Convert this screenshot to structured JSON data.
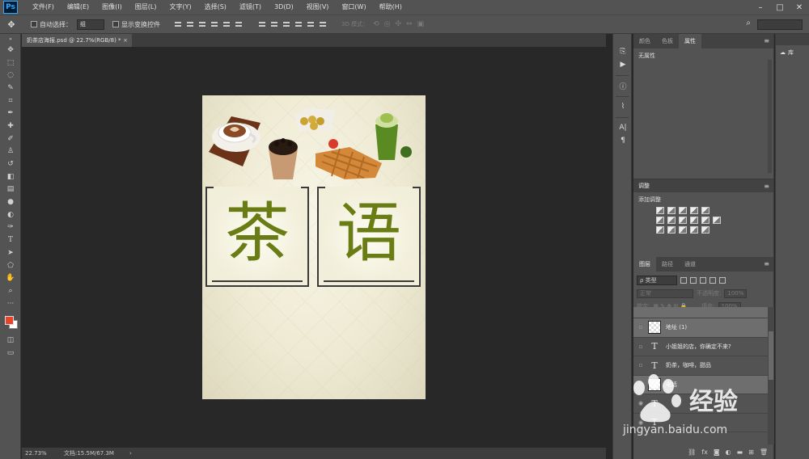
{
  "app": {
    "logo": "Ps"
  },
  "menu": [
    "文件(F)",
    "编辑(E)",
    "图像(I)",
    "图层(L)",
    "文字(Y)",
    "选择(S)",
    "滤镜(T)",
    "3D(D)",
    "视图(V)",
    "窗口(W)",
    "帮助(H)"
  ],
  "options": {
    "auto_select_label": "自动选择：",
    "auto_select_value": "组",
    "show_transform_label": "显示变换控件",
    "mode_3d_label": "3D 模式："
  },
  "document": {
    "tab_label": "奶茶店海报.psd @ 22.7%(RGB/8) *",
    "close": "×",
    "zoom": "22.73%",
    "doc_info": "文档:15.5M/67.3M",
    "status_arrow": "›"
  },
  "poster": {
    "title_char_1": "茶",
    "title_char_2": "语"
  },
  "panels": {
    "top_tabs": [
      "颜色",
      "色板",
      "属性"
    ],
    "properties_text": "无属性",
    "adjustments_tab": "调整",
    "adjustments_title": "添加调整",
    "layer_tabs": [
      "图层",
      "路径",
      "通道"
    ],
    "layer_filter": "ρ 类型",
    "blend_mode": "正常",
    "opacity_label": "不透明度:",
    "opacity_value": "100%",
    "lock_label": "锁定:",
    "fill_label": "填充:",
    "fill_value": "100%",
    "layers": [
      {
        "name": "",
        "kind": "image",
        "selected": true
      },
      {
        "name": "地址 (1)",
        "kind": "image",
        "selected": true
      },
      {
        "name": "小姐姐的店，你确定不来?",
        "kind": "text",
        "selected": false
      },
      {
        "name": "奶茶，咖啡，甜品",
        "kind": "text",
        "selected": false
      },
      {
        "name": "电话",
        "kind": "image",
        "selected": true
      },
      {
        "name": "",
        "kind": "text",
        "selected": false
      },
      {
        "name": "",
        "kind": "text",
        "selected": false
      }
    ],
    "menu_glyph": "≡"
  },
  "libraries": {
    "label": "库"
  },
  "watermark": {
    "text": "经验",
    "url": "jingyan.baidu.com"
  },
  "colors": {
    "foreground": "#e8442c",
    "background": "#ffffff",
    "title_green": "#6a7d14"
  }
}
